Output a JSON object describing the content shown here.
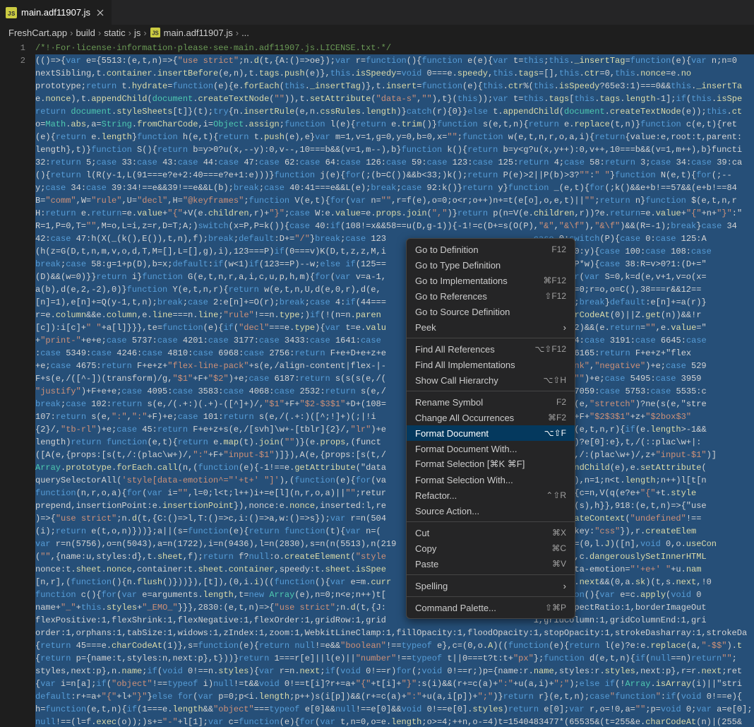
{
  "tab": {
    "filename": "main.adf11907.js",
    "icon_name": "js-file-icon"
  },
  "breadcrumbs": {
    "parts": [
      "FreshCart.app",
      "build",
      "static",
      "js",
      "main.adf11907.js",
      "..."
    ]
  },
  "gutter": {
    "lines": [
      "1",
      "2"
    ]
  },
  "code": {
    "line1": "/*! For license information please see main.adf11907.js.LICENSE.txt */",
    "lines": [
      "(()=>{var e={5513:(e,t,n)=>{\"use strict\";n.d(t,{A:()=>oe});var r=function(){function e(e){var t=this;this._insertTag=function(e){var n;n=0",
      "nextSibling,t.container.insertBefore(e,n),t.tags.push(e)},this.isSpeedy=void 0===e.speedy,this.tags=[],this.ctr=0,this.nonce=e.no",
      "prototype;return t.hydrate=function(e){e.forEach(this._insertTag)},t.insert=function(e){this.ctr%(this.isSpeedy?65e3:1)===0&&this._insertTa",
      "e.nonce),t.appendChild(document.createTextNode(\"\")),t.setAttribute(\"data-s\",\"\"),t}(this));var t=this.tags[this.tags.length-1];if(this.isSpe",
      "return document.styleSheets[t]}(t);try{n.insertRule(e,n.cssRules.length)}catch(r){0}}else t.appendChild(document.createTextNode(e));this.ct",
      "o=Math.abs,a=String.fromCharCode,i=Object.assign;function l(e){return e.trim()}function s(e,t,n){return e.replace(t,n)}function c(e,t){ret",
      "(e){return e.length}function h(e,t){return t.push(e),e}var m=1,v=1,g=0,y=0,b=0,x=\"\";function w(e,t,n,r,o,a,i){return{value:e,root:t,parent:",
      "length},t)}function S(){return b=y>0?u(x,--y):0,v--,10===b&&(v=1,m--),b}function k(){return b=y<g?u(x,y++):0,v++,10===b&&(v=1,m++),b}functi",
      "32:return 5;case 33:case 43:case 44:case 47:case 62:case 64:case 126:case 59:case 123:case 125:return 4;case 58:return 3;case 34:case 39:ca",
      "(){return l(R(y-1,L(91===e?e+2:40===e?e+1:e)))}function j(e){for(;(b=C())&&b<33;)k();return P(e)>2||P(b)>3?\"\":\" \"}function N(e,t){for(;--",
      "y;case 34:case 39:34!==e&&39!==e&&L(b);break;case 40:41===e&&L(e);break;case 92:k()}return y}function _(e,t){for(;k()&&e+b!==57&&(e+b!==84",
      "B=\"comm\",W=\"rule\",U=\"decl\",H=\"@keyframes\";function V(e,t){for(var n=\"\",r=f(e),o=0;o<r;o++)n+=t(e[o],o,e,t)||\"\";return n}function $(e,t,n,r",
      "H:return e.return=e.value+\"{\"+V(e.children,r)+\"}\";case W:e.value=e.props.join(\",\")}return p(n=V(e.children,r))?e.return=e.value+\"{\"+n+\"}\":\"",
      "R=1,P=0,T=\"\",M=o,L=i,z=r,D=T;A;)switch(x=P,P=k()){case 40:if(108!=x&&58==u(D,g-1)){-1!=c(D+=s(O(P),\"&\",\"&\\f\"),\"&\\f\")&&(R=-1);break}case 34",
      "42:case 47:h(X(_(k(),E()),t,n),f);break;default:D+=\"/\"}break;case 123                             case 0:switch(P){case 0:case 125:A",
      "(h(z=G(D,t,n,m,v,o,d,T,M=[],L=[],g),i),123===P)if(0===v)K(D,t,z,z,M,i                             ,D,3)?100:y){case 100:case 108:case",
      "break;case 58:g=1+p(D),b=x;default:if(w<1)if(123==P)--w;else if(125==                             D+=a(P),P*w){case 38:R=v>0?1:(D+=\"",
      "(D)&&(w=0)}}return i}function G(e,t,n,r,a,i,c,u,p,h,m){for(var v=a-1,                             r;++b)for(var S=0,k=d(e,v+1,v=o(x=",
      "a(b),d(e,2,-2),0)}function Y(e,t,n,r){return w(e,t,n,U,d(e,0,r),d(e,                             var r=0,o=0;r=o,o=C(),38===r&&12==",
      "[n]=1),e[n]+=Q(y-1,t,n);break;case 2:e[n]+=O(r);break;case 4:if(44===                             ].length;break}default:e[n]+=a(r)}",
      "r=e.column&&e.column,e.line===n.line;\"rule\"!==n.type;)if(!(n=n.paren                             8===t.charCodeAt(0)||Z.get(n))&&!r",
      "[c]):i[c]+\" \"+a[l]}}},te=function(e){if(\"decl\"===e.type){var t=e.valu                             rCodeAt(2)&&(e.return=\"\",e.value=\"",
      "+\"print-\"+e+e;case 5737:case 4201:case 3177:case 3433:case 1641:case                             ;case 5844:case 3191:case 6645:case",
      ":case 5349:case 4246:case 4810:case 6968:case 2756:return F+e+D+e+z+e                             +e;case 6165:return F+e+z+\"flex",
      "+e;case 4675:return F+e+z+\"flex-line-pack\"+s(e,/align-content|flex-|-                             (e,\"shrink\",\"negative\")+e;case 529",
      "F+s(e,/([^-])(transform)/g,\"$1\"+F+\"$2\")+e;case 6187:return s(s(s(e,/(                             \"$1\"),e,\"\")+e;case 5495:case 3959",
      "\"justify\")+F+e+e;case 4095:case 3583:case 4068:case 2532:return s(e,/                             16:case 7059:case 5753:case 5535:c",
      "break;case 102:return s(e,/(.+:)(.+)-([^]+)/,\"$1\"+F+\"$2-$3$1\"+D+(108=                             return-c(e,\"stretch\")?ne(s(e,\"stre",
      "107:return s(e,\":\",\":\"+F)+e;case 101:return s(e,/(.+:)([^;!]+)(;|!i                             +\"box$3$1\"+F+\"$2$3$1\"+z+\"$2box$3\"",
      "{2}/,\"tb-rl\")+e;case 45:return F+e+z+s(e,/[svh]\\w+-[tblr]{2}/,\"lr\")+e                             function(e,t,n,r){if(e.length>-1&&",
      "length)return function(e,t){return e.map(t).join(\"\")}(e.props,(funct                             t.exec(e))?e[0]:e},t,/(::plac\\w+|:",
      "([A(e,{props:[s(t,/:(plac\\w+)/,\":\"+F+\"input-$1\")]}),A(e,{props:[s(t,/                             rns:[s(t,/:(plac\\w+)/,z+\"input-$1\")]",
      "Array.prototype.forEach.call(n,(function(e){-1!==e.getAttribute(\"data                             ead.appendChild(e),e.setAttribute(",
      "querySelectorAll('style[data-emotion^=\"'+t+' \"]'),(function(e){for(va                             plit(\" \"),n=1;n<t.length;n++)l[t[n",
      "function(n,r,o,a){for(var i=\"\",l=0;l<t;l++)i+=e[l](n,r,o,a)||\"\";retur                             e,t,n,r){c=n,V(q(e?e+\"{\"+t.style",
      "prepend,insertionPoint:e.insertionPoint}),nonce:e.nonce,inserted:l,re                             .hydrate(s),h}},918:(e,t,n)=>{\"use",
      ")=>{\"use strict\";n.d(t,{C:()=>l,T:()=>c,i:()=>a,w:()=>s});var r=n(504                             ,i=r.createContext(\"undefined\"!==",
      "(i);return e(t,o,n)}))};a||(s=function(e){return function(t){var n=(                             (0,o.A)({key:\"css\"}),r.createElem",
      "var r=n(5756),o=n(5043),a=n(1722),i=n(9436),l=n(2830),s=n(n(5513),n(219                             yles,s=(0,l.J)([n],void 0,o.useCon",
      "(\"\",{name:u,styles:d},t.sheet,f);return f?null:o.createElement(\"style                             obal \"+u,c.dangerouslySetInnerHTML",
      "nonce:t.sheet.nonce,container:t.sheet.container,speedy:t.sheet.isSpee                             style[data-emotion=\"'+e+' \"+u.nam",
      "[n,r],(function(){n.flush()}))}),[t]),(0,i.i)((function(){var e=m.curr                             d 0!==s.next&&(0,a.sk)(t,s.next,!0",
      "function c(){for(var e=arguments.length,t=new Array(e),n=0;n<e;n++)t[                             u=function(){var e=c.apply(void 0",
      "name+\"_\"+this.styles+\"_EMO_\"}}},2830:(e,t,n)=>{\"use strict\";n.d(t,{J:                             unt:1,aspectRatio:1,borderImageOut",
      "flexPositive:1,flexShrink:1,flexNegative:1,flexOrder:1,gridRow:1,grid                             1,gridColumn:1,gridColumnEnd:1,gri",
      "order:1,orphans:1,tabSize:1,widows:1,zIndex:1,zoom:1,WebkitLineClamp:1,fillOpacity:1,floodOpacity:1,stopOpacity:1,strokeDasharray:1,strokeDa",
      "{return 45===e.charCodeAt(1)},s=function(e){return null!=e&&\"boolean\"!==typeof e},c=(0,o.A)((function(e){return l(e)?e:e.replace(a,\"-$$\").t",
      "{return p={name:t,styles:n,next:p},t}))}return 1===r[e]||l(e)||\"number\"!==typeof t||0===t?t:t+\"px\"};function d(e,t,n){if(null==n)return\"\";",
      "styles,next:p},n.name;if(void 0!==n.styles){var r=n.next;if(void 0!==r)for(;void 0!==r;)p={name:r.name,styles:r.styles,next:p},r=r.next;ret",
      "{var i=n[a];if(\"object\"!==typeof i)null!=t&&void 0!==t[i]?r+=a+\"{\"+t[i]+\"}\":s(i)&&(r+=c(a)+\":\"+u(a,i)+\";\");else if(!Array.isArray(i)||\"stri",
      "default:r+=a+\"{\"+l+\"}\"}else for(var p=0;p<i.length;p++)s(i[p])&&(r+=c(a)+\":\"+u(a,i[p])+\";\")}return r}(e,t,n);case\"function\":if(void 0!==e){",
      "h=function(e,t,n){if(1===e.length&&\"object\"===typeof e[0]&&null!==e[0]&&void 0!==e[0].styles)return e[0];var r,o=!0,a=\"\";p=void 0;var a=e[0];",
      "null!==(l=f.exec(o));)s+=\"-\"+l[1];var c=function(e){for(var t,n=0,o=e.length;o>=4;++n,o-=4)t=1540483477*(65535&(t=255&e.charCodeAt(n)|(255&"
    ]
  },
  "context_menu": {
    "items": [
      {
        "label": "Go to Definition",
        "shortcut": "F12"
      },
      {
        "label": "Go to Type Definition",
        "shortcut": ""
      },
      {
        "label": "Go to Implementations",
        "shortcut": "⌘F12"
      },
      {
        "label": "Go to References",
        "shortcut": "⇧F12"
      },
      {
        "label": "Go to Source Definition",
        "shortcut": ""
      },
      {
        "label": "Peek",
        "submenu": true
      },
      {
        "sep": true
      },
      {
        "label": "Find All References",
        "shortcut": "⌥⇧F12"
      },
      {
        "label": "Find All Implementations",
        "shortcut": ""
      },
      {
        "label": "Show Call Hierarchy",
        "shortcut": "⌥⇧H"
      },
      {
        "sep": true
      },
      {
        "label": "Rename Symbol",
        "shortcut": "F2"
      },
      {
        "label": "Change All Occurrences",
        "shortcut": "⌘F2"
      },
      {
        "label": "Format Document",
        "shortcut": "⌥⇧F",
        "selected": true
      },
      {
        "label": "Format Document With...",
        "shortcut": ""
      },
      {
        "label": "Format Selection [⌘K ⌘F]",
        "shortcut": ""
      },
      {
        "label": "Format Selection With...",
        "shortcut": ""
      },
      {
        "label": "Refactor...",
        "shortcut": "⌃⇧R"
      },
      {
        "label": "Source Action...",
        "shortcut": ""
      },
      {
        "sep": true
      },
      {
        "label": "Cut",
        "shortcut": "⌘X"
      },
      {
        "label": "Copy",
        "shortcut": "⌘C"
      },
      {
        "label": "Paste",
        "shortcut": "⌘V"
      },
      {
        "sep": true
      },
      {
        "label": "Spelling",
        "submenu": true
      },
      {
        "sep": true
      },
      {
        "label": "Command Palette...",
        "shortcut": "⇧⌘P"
      }
    ]
  }
}
